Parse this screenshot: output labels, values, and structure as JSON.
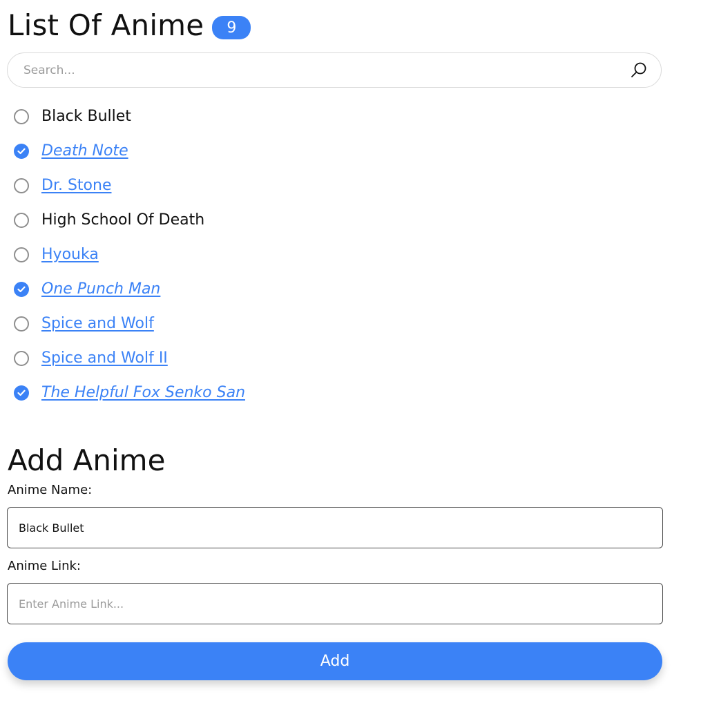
{
  "header": {
    "title": "List Of Anime",
    "count": "9"
  },
  "search": {
    "placeholder": "Search...",
    "value": ""
  },
  "anime_list": [
    {
      "name": "Black Bullet",
      "checked": false,
      "has_link": false
    },
    {
      "name": "Death Note",
      "checked": true,
      "has_link": true
    },
    {
      "name": "Dr. Stone",
      "checked": false,
      "has_link": true
    },
    {
      "name": "High School Of Death",
      "checked": false,
      "has_link": false
    },
    {
      "name": "Hyouka",
      "checked": false,
      "has_link": true
    },
    {
      "name": "One Punch Man",
      "checked": true,
      "has_link": true
    },
    {
      "name": "Spice and Wolf",
      "checked": false,
      "has_link": true
    },
    {
      "name": "Spice and Wolf II",
      "checked": false,
      "has_link": true
    },
    {
      "name": "The Helpful Fox Senko San",
      "checked": true,
      "has_link": true
    }
  ],
  "add_form": {
    "title": "Add Anime",
    "name_label": "Anime Name:",
    "name_value": "Black Bullet",
    "name_placeholder": "",
    "link_label": "Anime Link:",
    "link_value": "",
    "link_placeholder": "Enter Anime Link...",
    "add_button_label": "Add"
  },
  "colors": {
    "accent": "#3b82f6",
    "text": "#111111",
    "unchecked_border": "#8e8e8e"
  },
  "icons": {
    "search": "search-icon",
    "checked": "check-circle-icon",
    "unchecked": "empty-circle-icon"
  }
}
